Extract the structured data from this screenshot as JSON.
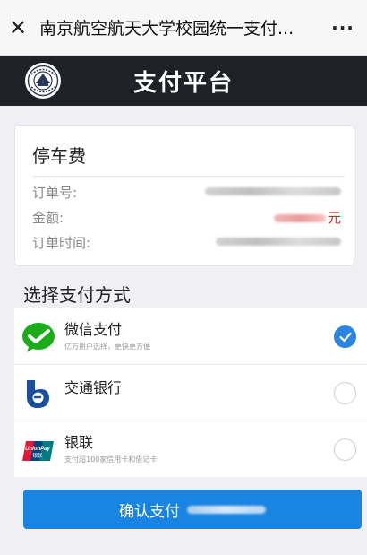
{
  "topbar": {
    "close_icon": "close-icon",
    "title": "南京航空航天大学校园统一支付...",
    "more_icon": "more-icon"
  },
  "header": {
    "logo": "university-seal-logo",
    "title": "支付平台",
    "background": "#1e2228"
  },
  "order": {
    "title": "停车费",
    "rows": [
      {
        "label": "订单号:",
        "value": ""
      },
      {
        "label": "金额:",
        "value": "",
        "unit": "元"
      },
      {
        "label": "订单时间:",
        "value": ""
      }
    ]
  },
  "payment": {
    "section_title": "选择支付方式",
    "methods": [
      {
        "name": "微信支付",
        "desc": "亿万用户选择，更快更方便",
        "icon": "wechat-pay-icon",
        "selected": true
      },
      {
        "name": "交通银行",
        "desc": "",
        "icon": "bocom-icon",
        "selected": false
      },
      {
        "name": "银联",
        "desc": "支付超100家信用卡和借记卡",
        "icon": "unionpay-icon",
        "selected": false
      }
    ]
  },
  "confirm": {
    "label": "确认支付"
  },
  "colors": {
    "accent": "#1a84e2",
    "check": "#2a86e0",
    "amount": "#e02020",
    "wechat_green": "#1aad19"
  }
}
